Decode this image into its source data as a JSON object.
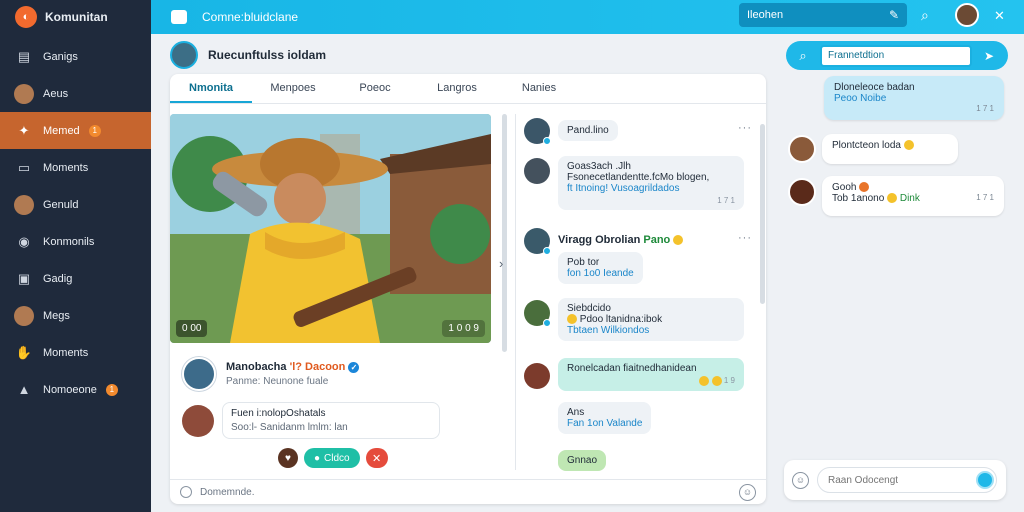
{
  "app": {
    "brand": "Komunitan",
    "title": "Comne:bluidclane"
  },
  "sidebar": {
    "items": [
      {
        "label": "Ganigs",
        "icon": "storefront-icon",
        "active": false,
        "badge": ""
      },
      {
        "label": "Aeus",
        "icon": "avatar-icon",
        "active": false,
        "badge": ""
      },
      {
        "label": "Memed",
        "icon": "handshake-icon",
        "active": true,
        "badge": "1"
      },
      {
        "label": "Moments",
        "icon": "chat-icon",
        "active": false,
        "badge": ""
      },
      {
        "label": "Genuld",
        "icon": "avatar-icon",
        "active": false,
        "badge": ""
      },
      {
        "label": "Konmonils",
        "icon": "target-icon",
        "active": false,
        "badge": ""
      },
      {
        "label": "Gadig",
        "icon": "message-icon",
        "active": false,
        "badge": ""
      },
      {
        "label": "Megs",
        "icon": "avatar-icon",
        "active": false,
        "badge": ""
      },
      {
        "label": "Moments",
        "icon": "hand-icon",
        "active": false,
        "badge": ""
      },
      {
        "label": "Nomoeone",
        "icon": "bell-icon",
        "active": false,
        "badge": "1"
      }
    ]
  },
  "topbar": {
    "search_value": "Ileohen"
  },
  "main": {
    "title": "Ruecunftulss ioldam",
    "tabs": [
      "Nmonita",
      "Menpoes",
      "Poeoc",
      "Langros",
      "Nanies"
    ],
    "media": {
      "left_stat": "0  00",
      "right_stat": "1 0 0 9"
    },
    "post": {
      "author_a": "Manobacha",
      "author_b": "'l? Dacoon",
      "subtitle": "Panme: Neunone fuale"
    },
    "comment": {
      "line1": "Fuen i:nolopOshatals",
      "line2": "Soo:l- Sanidanm lmlm: lan"
    },
    "reactions": {
      "pill_label": "Cldco"
    },
    "footer_text": "Domemnde."
  },
  "thread": [
    {
      "type": "name",
      "text": "Pand.lino"
    },
    {
      "type": "bubble",
      "line1": "Goas3ach  .Jlh",
      "line2": "Fsonecetlandentte.fcMo blogen,",
      "line3": "ft Itnoing! Vusoagrildados",
      "ts": "1 7 1"
    },
    {
      "type": "heading",
      "text_a": "Viragg Obrolian ",
      "text_b": "Pano"
    },
    {
      "type": "bubble",
      "line1": "Pob tor",
      "line2": "fon 1o0 Ieande"
    },
    {
      "type": "bubble",
      "line1": "Siebdcido",
      "line2": "Pdoo ltanidna:ibok",
      "line3": "Tbtaen Wilkiondos"
    },
    {
      "type": "bubble",
      "line1": "Ronelcadan fiaitnedhanidean",
      "ts": "1 9"
    },
    {
      "type": "bubble",
      "line1": "Ans",
      "line2": "Fan 1on Valande"
    },
    {
      "type": "bubble",
      "line1": "Gnnao"
    }
  ],
  "right": {
    "search_value": "Frannetdtion",
    "messages": [
      {
        "line1": "Dloneleoce badan",
        "line2": "Peoo Noibe",
        "ts": "1 7 1"
      },
      {
        "line1": "Plontcteon loda"
      },
      {
        "line1": "Gooh",
        "line2": "Tob 1anono",
        "line2_b": "Dink",
        "ts": "1 7 1"
      }
    ],
    "composer_placeholder": "Raan Odocengt"
  },
  "colors": {
    "accent": "#1fb8e8",
    "sidebar_bg": "#1f2a3c",
    "active_nav": "#c6652e"
  }
}
